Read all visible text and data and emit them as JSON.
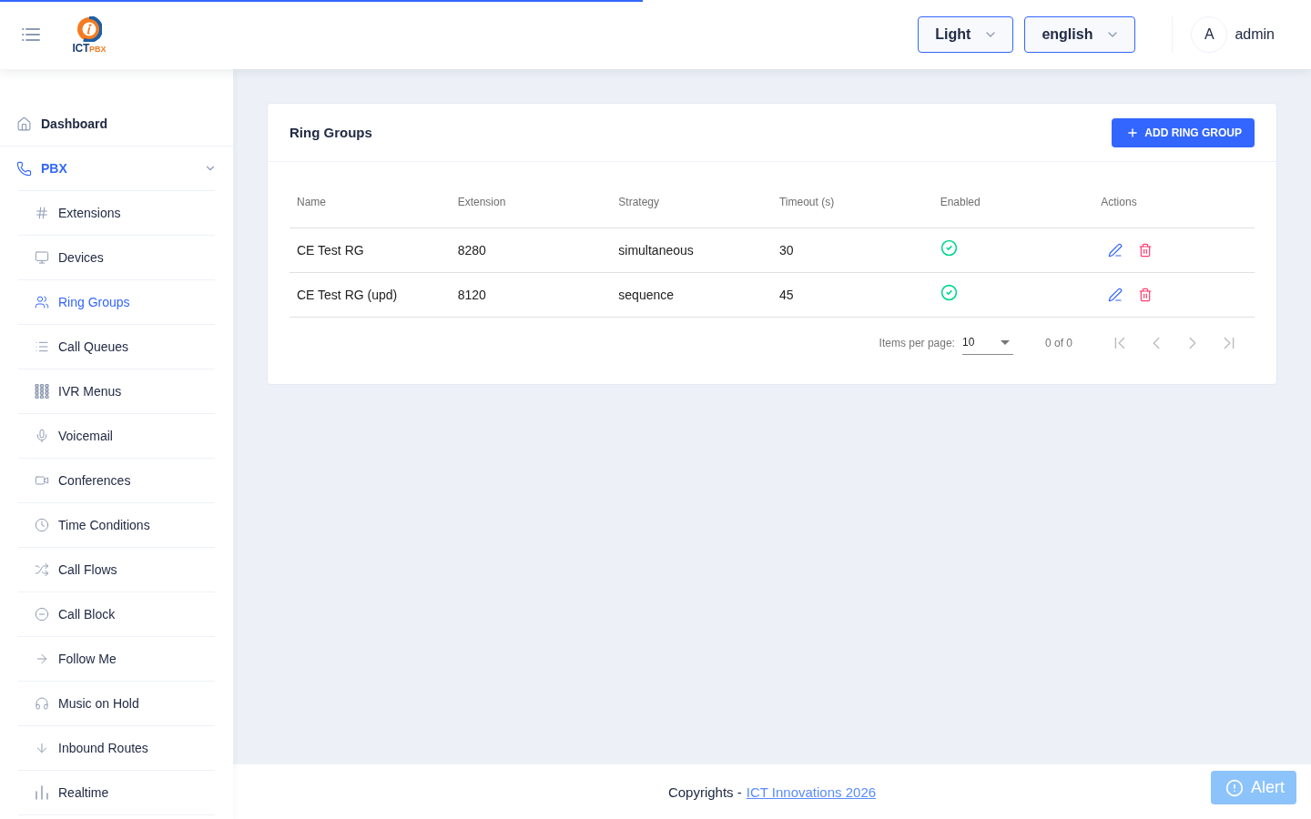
{
  "loading_bar": {
    "level": 0.49
  },
  "header": {
    "logo": {
      "text": "ICT",
      "accent_text": "PBX"
    },
    "theme_select": {
      "value": "Light"
    },
    "language_select": {
      "value": "english"
    },
    "user": {
      "initial": "A",
      "name": "admin"
    }
  },
  "sidebar": {
    "items": [
      {
        "label": "Dashboard",
        "selected": false
      },
      {
        "label": "PBX",
        "selected": true,
        "expanded": true,
        "children": [
          {
            "label": "Extensions",
            "selected": false
          },
          {
            "label": "Devices",
            "selected": false
          },
          {
            "label": "Ring Groups",
            "selected": true
          },
          {
            "label": "Call Queues",
            "selected": false
          },
          {
            "label": "IVR Menus",
            "selected": false
          },
          {
            "label": "Voicemail",
            "selected": false
          },
          {
            "label": "Conferences",
            "selected": false
          },
          {
            "label": "Time Conditions",
            "selected": false
          },
          {
            "label": "Call Flows",
            "selected": false
          },
          {
            "label": "Call Block",
            "selected": false
          },
          {
            "label": "Follow Me",
            "selected": false
          },
          {
            "label": "Music on Hold",
            "selected": false
          },
          {
            "label": "Inbound Routes",
            "selected": false
          },
          {
            "label": "Realtime",
            "selected": false
          }
        ]
      }
    ]
  },
  "card": {
    "title": "Ring Groups",
    "add_button": {
      "label": "ADD RING GROUP"
    },
    "table": {
      "columns": [
        "Name",
        "Extension",
        "Strategy",
        "Timeout (s)",
        "Enabled",
        "Actions"
      ],
      "rows": [
        {
          "name": "CE Test RG",
          "extension": "8280",
          "strategy": "simultaneous",
          "timeout": "30",
          "enabled": true
        },
        {
          "name": "CE Test RG (upd)",
          "extension": "8120",
          "strategy": "sequence",
          "timeout": "45",
          "enabled": true
        }
      ]
    },
    "paginator": {
      "label": "Items per page:",
      "page_size": "10",
      "range": "0 of 0",
      "buttons": [
        {
          "kind": "first",
          "disabled": true
        },
        {
          "kind": "previous",
          "disabled": true
        },
        {
          "kind": "next",
          "disabled": true
        },
        {
          "kind": "last",
          "disabled": true
        }
      ]
    }
  },
  "footer": {
    "text": "Copyrights -",
    "link": "ICT Innovations 2026"
  },
  "alert_button": {
    "label": "Alert"
  }
}
